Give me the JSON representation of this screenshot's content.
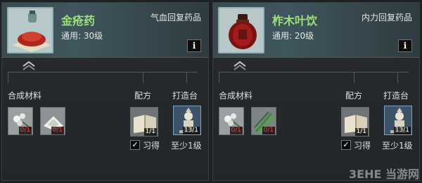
{
  "panels": [
    {
      "name": "金疮药",
      "level": "通用: 30级",
      "type": "气血回复药品",
      "info": "i",
      "labels": {
        "materials": "合成材料",
        "recipe": "配方",
        "forge": "打造台"
      },
      "materials": [
        {
          "icon": "flower-herb-icon",
          "count": "0/1"
        },
        {
          "icon": "powder-pile-icon",
          "count": "0/1"
        }
      ],
      "recipe": {
        "icon": "recipe-book-icon",
        "count": "1/1",
        "status": "习得",
        "checked": "✓"
      },
      "forge": {
        "icon": "forge-statue-icon",
        "count": "13/1",
        "requirement": "至少1级"
      }
    },
    {
      "name": "柞木叶饮",
      "level": "通用: 20级",
      "type": "内力回复药品",
      "info": "i",
      "labels": {
        "materials": "合成材料",
        "recipe": "配方",
        "forge": "打造台"
      },
      "materials": [
        {
          "icon": "flower-herb-icon",
          "count": "0/1"
        },
        {
          "icon": "green-stalks-icon",
          "count": "0/1"
        }
      ],
      "recipe": {
        "icon": "recipe-book-icon",
        "count": "1/1",
        "status": "习得",
        "checked": "✓"
      },
      "forge": {
        "icon": "forge-statue-icon",
        "count": "13/1",
        "requirement": "至少1级"
      }
    }
  ],
  "watermark": "3ЕНЕ 当游网",
  "colors": {
    "name": "#9be07a",
    "count_missing": "#ff3b3b",
    "count_ok": "#ffffff"
  }
}
